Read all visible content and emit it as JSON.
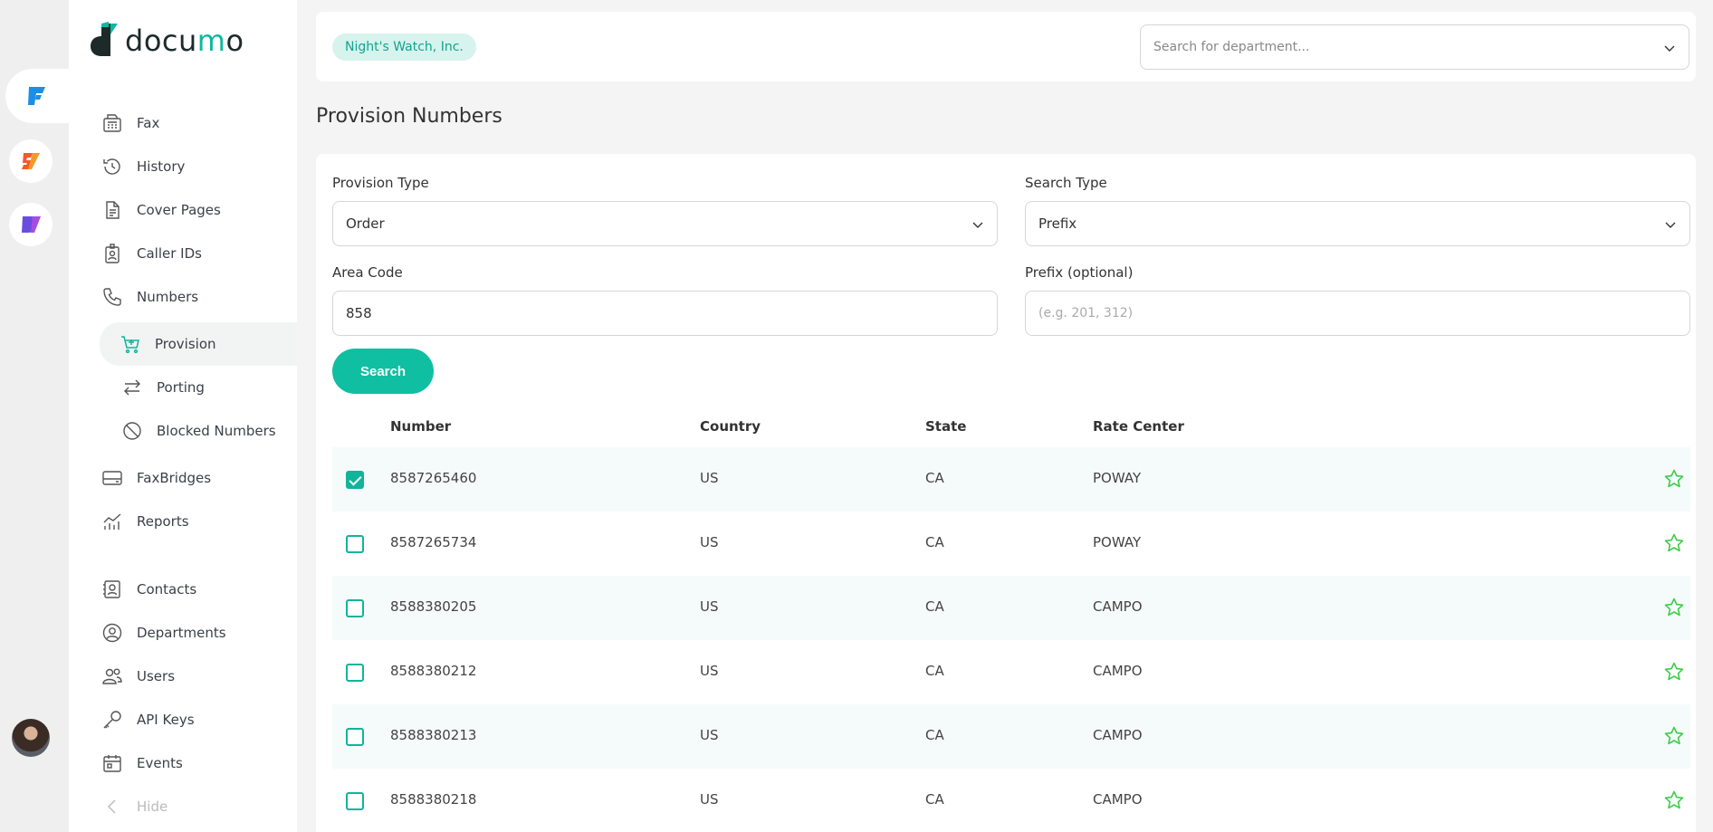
{
  "colors": {
    "accent": "#10bfa2",
    "badge_bg": "#d7f3ee",
    "star": "#3ccc4a"
  },
  "brand": {
    "name_prefix": "docu",
    "name_accent": "m",
    "name_suffix": "o"
  },
  "sidebar": {
    "items": [
      {
        "label": "Fax",
        "icon": "fax-icon"
      },
      {
        "label": "History",
        "icon": "history-icon"
      },
      {
        "label": "Cover Pages",
        "icon": "document-icon"
      },
      {
        "label": "Caller IDs",
        "icon": "badge-icon"
      },
      {
        "label": "Numbers",
        "icon": "phone-icon"
      },
      {
        "label": "Provision",
        "icon": "cart-icon"
      },
      {
        "label": "Porting",
        "icon": "swap-icon"
      },
      {
        "label": "Blocked Numbers",
        "icon": "blocked-icon"
      },
      {
        "label": "FaxBridges",
        "icon": "card-icon"
      },
      {
        "label": "Reports",
        "icon": "chart-icon"
      },
      {
        "label": "Contacts",
        "icon": "contact-icon"
      },
      {
        "label": "Departments",
        "icon": "departments-icon"
      },
      {
        "label": "Users",
        "icon": "users-icon"
      },
      {
        "label": "API Keys",
        "icon": "key-icon"
      },
      {
        "label": "Events",
        "icon": "calendar-icon"
      }
    ],
    "hide_label": "Hide"
  },
  "header": {
    "org": "Night's Watch, Inc.",
    "dept_search_placeholder": "Search for department..."
  },
  "page": {
    "title": "Provision Numbers"
  },
  "form": {
    "provision_type_label": "Provision Type",
    "provision_type_value": "Order",
    "search_type_label": "Search Type",
    "search_type_value": "Prefix",
    "area_code_label": "Area Code",
    "area_code_value": "858",
    "prefix_label": "Prefix (optional)",
    "prefix_placeholder": "(e.g. 201, 312)",
    "search_button": "Search"
  },
  "table": {
    "columns": [
      "Number",
      "Country",
      "State",
      "Rate Center"
    ],
    "rows": [
      {
        "number": "8587265460",
        "country": "US",
        "state": "CA",
        "rate_center": "POWAY",
        "checked": true
      },
      {
        "number": "8587265734",
        "country": "US",
        "state": "CA",
        "rate_center": "POWAY",
        "checked": false
      },
      {
        "number": "8588380205",
        "country": "US",
        "state": "CA",
        "rate_center": "CAMPO",
        "checked": false
      },
      {
        "number": "8588380212",
        "country": "US",
        "state": "CA",
        "rate_center": "CAMPO",
        "checked": false
      },
      {
        "number": "8588380213",
        "country": "US",
        "state": "CA",
        "rate_center": "CAMPO",
        "checked": false
      },
      {
        "number": "8588380218",
        "country": "US",
        "state": "CA",
        "rate_center": "CAMPO",
        "checked": false
      }
    ]
  }
}
